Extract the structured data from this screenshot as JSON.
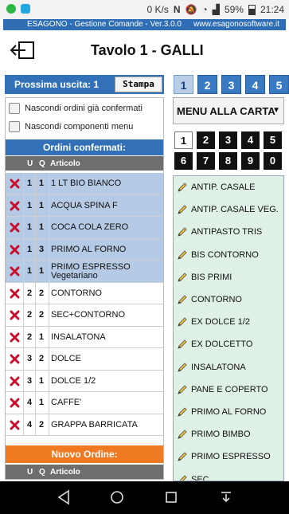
{
  "statusbar": {
    "network_speed": "0 K/s",
    "battery": "59%",
    "time": "21:24"
  },
  "appbar": {
    "title": "ESAGONO - Gestione Comande - Ver.3.0.0",
    "website": "www.esagonosoftware.it"
  },
  "header": {
    "title": "Tavolo 1 - GALLI"
  },
  "prossima": {
    "label": "Prossima uscita: 1",
    "print_button": "Stampa"
  },
  "uscita_tabs": [
    "1",
    "2",
    "3",
    "4",
    "5"
  ],
  "options": {
    "hide_confirmed": "Nascondi ordini già confermati",
    "hide_components": "Nascondi componenti menu"
  },
  "confirmed": {
    "title": "Ordini confermati:",
    "columns": {
      "u": "U",
      "q": "Q",
      "articolo": "Articolo"
    },
    "rows": [
      {
        "u": "1",
        "q": "1",
        "articolo": "1 LT BIO BIANCO",
        "confirmed": true
      },
      {
        "u": "1",
        "q": "1",
        "articolo": "ACQUA SPINA F",
        "confirmed": true
      },
      {
        "u": "1",
        "q": "1",
        "articolo": "COCA COLA ZERO",
        "confirmed": true
      },
      {
        "u": "1",
        "q": "3",
        "articolo": "PRIMO AL FORNO",
        "confirmed": true
      },
      {
        "u": "1",
        "q": "1",
        "articolo": "PRIMO ESPRESSO Vegetariano",
        "confirmed": true
      },
      {
        "u": "2",
        "q": "2",
        "articolo": "CONTORNO",
        "confirmed": false
      },
      {
        "u": "2",
        "q": "2",
        "articolo": "SEC+CONTORNO",
        "confirmed": false
      },
      {
        "u": "2",
        "q": "1",
        "articolo": "INSALATONA",
        "confirmed": false
      },
      {
        "u": "3",
        "q": "2",
        "articolo": "DOLCE",
        "confirmed": false
      },
      {
        "u": "3",
        "q": "1",
        "articolo": "DOLCE 1/2",
        "confirmed": false
      },
      {
        "u": "4",
        "q": "1",
        "articolo": "CAFFE'",
        "confirmed": false
      },
      {
        "u": "4",
        "q": "2",
        "articolo": "GRAPPA BARRICATA",
        "confirmed": false
      }
    ]
  },
  "new_order": {
    "title": "Nuovo Ordine:",
    "columns": {
      "u": "U",
      "q": "Q",
      "articolo": "Articolo"
    }
  },
  "menu_select": {
    "value": "MENU ALLA CARTA"
  },
  "number_grid": [
    "1",
    "2",
    "3",
    "4",
    "5",
    "6",
    "7",
    "8",
    "9",
    "0"
  ],
  "menu_items": [
    "ANTIP. CASALE",
    "ANTIP. CASALE VEG.",
    "ANTIPASTO TRIS",
    "BIS CONTORNO",
    "BIS PRIMI",
    "CONTORNO",
    "EX DOLCE 1/2",
    "EX DOLCETTO",
    "INSALATONA",
    "PANE E COPERTO",
    "PRIMO AL FORNO",
    "PRIMO BIMBO",
    "PRIMO ESPRESSO",
    "SEC"
  ],
  "colors": {
    "primary_blue": "#3271b8",
    "confirmed_row": "#b5cae4",
    "new_order_orange": "#f07a22",
    "menu_panel": "#dff0e6"
  }
}
